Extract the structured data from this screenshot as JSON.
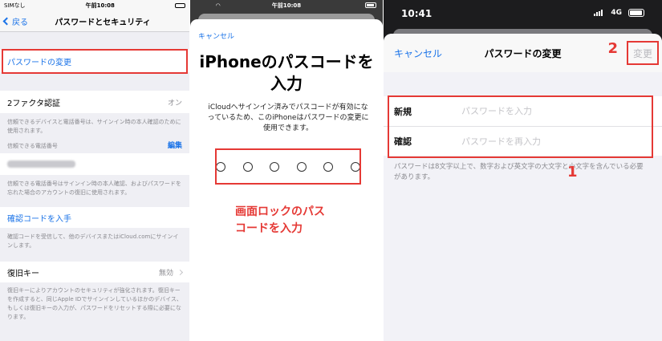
{
  "panel1": {
    "status": {
      "carrier": "SIMなし",
      "time": "午前10:08"
    },
    "nav": {
      "back": "戻る",
      "title": "パスワードとセキュリティ"
    },
    "change_password": "パスワードの変更",
    "two_factor": {
      "label": "2ファクタ認証",
      "value": "オン"
    },
    "two_factor_note": "信頼できるデバイスと電話番号は、サインイン時の本人確認のために使用されます。",
    "trusted_number_label": "信頼できる電話番号",
    "edit": "編集",
    "trusted_number_note": "信頼できる電話番号はサインイン時の本人確認、およびパスワードを忘れた場合のアカウントの復旧に使用されます。",
    "get_code": "確認コードを入手",
    "get_code_note": "確認コードを受信して、他のデバイスまたはiCloud.comにサインインします。",
    "recovery_key": {
      "label": "復旧キー",
      "value": "無効"
    },
    "recovery_note": "復旧キーによりアカウントのセキュリティが強化されます。復旧キーを作成すると、同じApple IDでサインインしているほかのデバイス、もしくは復旧キーの入力が、パスワードをリセットする際に必要になります。"
  },
  "panel2": {
    "status": {
      "time": "午前10:08"
    },
    "cancel": "キャンセル",
    "title_line1": "iPhoneのパスコードを",
    "title_line2": "入力",
    "description": "iCloudへサインイン済みでパスコードが有効になっているため、このiPhoneはパスワードの変更に使用できます。",
    "annotation_line1": "画面ロックのパス",
    "annotation_line2": "コードを入力"
  },
  "panel3": {
    "status": {
      "time": "10:41",
      "network": "4G"
    },
    "cancel": "キャンセル",
    "title": "パスワードの変更",
    "change": "変更",
    "new_label": "新規",
    "new_placeholder": "パスワードを入力",
    "confirm_label": "確認",
    "confirm_placeholder": "パスワードを再入力",
    "note": "パスワードは8文字以上で、数字および英文字の大文字と小文字を含んでいる必要があります。",
    "annotation_1": "1",
    "annotation_2": "2"
  },
  "colors": {
    "accent": "#1a73e8",
    "annotation_red": "#e53935"
  }
}
